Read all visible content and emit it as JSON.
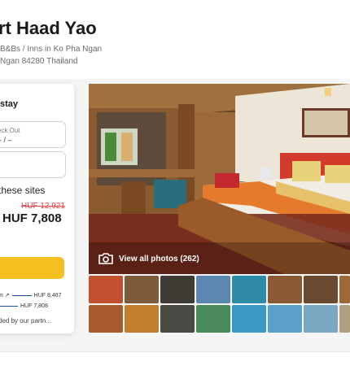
{
  "header": {
    "title": "rt Haad Yao",
    "breadcrumbs": "B&Bs / Inns in Ko Pha Ngan",
    "address": "Ngan 84280 Thailand"
  },
  "booking": {
    "heading": "stay",
    "checkout_label": "eck Out",
    "checkout_value": "– / –",
    "sites_text": "these sites",
    "old_price": "HUF 12,921",
    "new_price": "HUF 7,808",
    "offers": [
      {
        "label": "m ↗",
        "price": "HUF 8,467"
      },
      {
        "label": "",
        "price": "HUF 7,808"
      }
    ],
    "provided_by": "ded by our partn..."
  },
  "gallery": {
    "view_all": "View all photos (262)",
    "camera_icon": "camera-icon"
  },
  "colors": {
    "accent": "#f6bf1f",
    "price_strike": "#d64141",
    "link": "#1f4f9f"
  }
}
